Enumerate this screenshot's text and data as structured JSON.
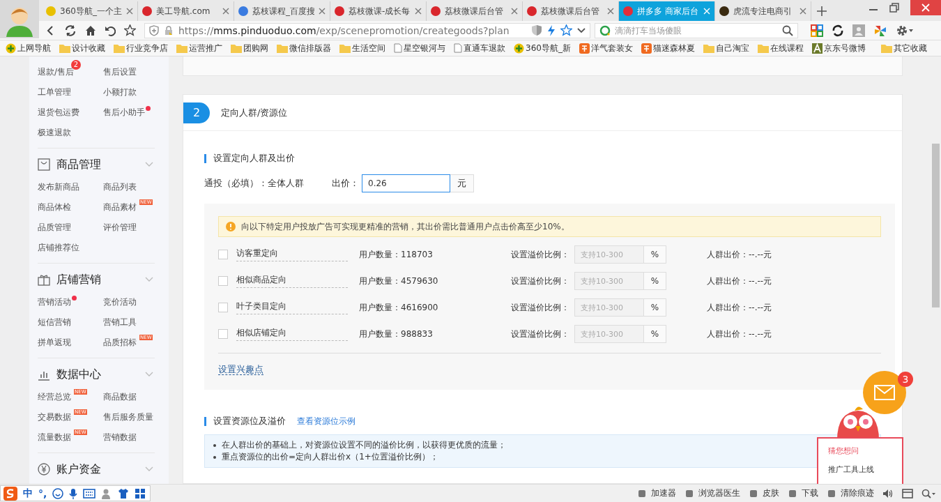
{
  "browser": {
    "tabs": [
      {
        "title": "360导航_一个主",
        "selected": false
      },
      {
        "title": "美工导航.com",
        "selected": false
      },
      {
        "title": "荔枝课程_百度搜",
        "selected": false
      },
      {
        "title": "荔枝微课-成长每",
        "selected": false
      },
      {
        "title": "荔枝微课后台管",
        "selected": false
      },
      {
        "title": "荔枝微课后台管",
        "selected": false
      },
      {
        "title": "拼多多 商家后台",
        "selected": true
      },
      {
        "title": "虎流专注电商引",
        "selected": false
      }
    ],
    "address": {
      "scheme": "https://",
      "host": "mms.pinduoduo.com",
      "path": "/exp/scenepromotion/creategoods?plan"
    },
    "search": {
      "placeholder": "滴滴打车当场傻眼"
    },
    "bookmarks": [
      {
        "label": "上网导航",
        "kind": "site"
      },
      {
        "label": "设计收藏",
        "kind": "folder"
      },
      {
        "label": "行业竞争店",
        "kind": "folder"
      },
      {
        "label": "运营推广",
        "kind": "folder"
      },
      {
        "label": "团购网",
        "kind": "folder"
      },
      {
        "label": "微信排版器",
        "kind": "folder"
      },
      {
        "label": "生活空间",
        "kind": "folder"
      },
      {
        "label": "星空银河与",
        "kind": "page"
      },
      {
        "label": "直通车退款",
        "kind": "page"
      },
      {
        "label": "360导航_新",
        "kind": "site"
      },
      {
        "label": "洋气套装女",
        "kind": "tao"
      },
      {
        "label": "猫迷森林夏",
        "kind": "tao"
      },
      {
        "label": "自己淘宝",
        "kind": "folder"
      },
      {
        "label": "在线课程",
        "kind": "folder"
      },
      {
        "label": "京东号微博",
        "kind": "letter"
      }
    ],
    "other_bookmarks": "其它收藏"
  },
  "sidebar": {
    "top_items": [
      {
        "label": "退款/售后",
        "badge": "2",
        "dot": false
      },
      {
        "label": "售后设置",
        "dot": false
      },
      {
        "label": "工单管理",
        "dot": false
      },
      {
        "label": "小额打款",
        "dot": false
      },
      {
        "label": "退货包运费",
        "dot": false
      },
      {
        "label": "售后小助手",
        "dot": true
      },
      {
        "label": "极速退款",
        "dot": false
      }
    ],
    "groups": [
      {
        "title": "商品管理",
        "items": [
          {
            "label": "发布新商品",
            "dot": false
          },
          {
            "label": "商品列表",
            "dot": false
          },
          {
            "label": "商品体检",
            "dot": false
          },
          {
            "label": "商品素材",
            "tag": "NEW",
            "dot": false
          },
          {
            "label": "品质管理",
            "dot": false
          },
          {
            "label": "评价管理",
            "dot": false
          },
          {
            "label": "店铺推荐位",
            "dot": false
          }
        ]
      },
      {
        "title": "店铺营销",
        "items": [
          {
            "label": "营销活动",
            "dot": true
          },
          {
            "label": "竞价活动",
            "dot": false
          },
          {
            "label": "短信营销",
            "dot": false
          },
          {
            "label": "营销工具",
            "dot": false
          },
          {
            "label": "拼单返现",
            "dot": false
          },
          {
            "label": "品质招标",
            "tag": "NEW",
            "dot": false
          }
        ]
      },
      {
        "title": "数据中心",
        "items": [
          {
            "label": "经营总览",
            "tag": "NEW",
            "dot": false
          },
          {
            "label": "商品数据",
            "dot": false
          },
          {
            "label": "交易数据",
            "tag": "NEW",
            "dot": false
          },
          {
            "label": "售后服务质量",
            "dot": false
          },
          {
            "label": "流量数据",
            "tag": "NEW",
            "dot": false
          },
          {
            "label": "营销数据",
            "dot": false
          }
        ]
      },
      {
        "title": "账户资金"
      }
    ]
  },
  "step": {
    "number": "2",
    "title": "定向人群/资源位"
  },
  "crowd_section": {
    "title": "设置定向人群及出价",
    "general_label": "通投（必填）：全体人群",
    "bid_label": "出价：",
    "bid_value": "0.26",
    "unit": "元",
    "notice": "向以下特定用户投放广告可实现更精准的营销，其出价需比普通用户点击价高至少10%。",
    "targets": [
      {
        "name": "访客重定向",
        "users": "用户数量：118703",
        "premium_label": "设置溢价比例：",
        "placeholder": "支持10-300",
        "percent": "%",
        "price": "人群出价：--.--元",
        "checked": false
      },
      {
        "name": "相似商品定向",
        "users": "用户数量：4579630",
        "premium_label": "设置溢价比例：",
        "placeholder": "支持10-300",
        "percent": "%",
        "price": "人群出价：--.--元",
        "checked": false
      },
      {
        "name": "叶子类目定向",
        "users": "用户数量：4616900",
        "premium_label": "设置溢价比例：",
        "placeholder": "支持10-300",
        "percent": "%",
        "price": "人群出价：--.--元",
        "checked": false
      },
      {
        "name": "相似店铺定向",
        "users": "用户数量：988833",
        "premium_label": "设置溢价比例：",
        "placeholder": "支持10-300",
        "percent": "%",
        "price": "人群出价：--.--元",
        "checked": false
      }
    ],
    "interest_link": "设置兴趣点"
  },
  "resource_section": {
    "title": "设置资源位及溢价",
    "example_link": "查看资源位示例",
    "bullets": [
      "在人群出价的基础上，对资源位设置不同的溢价比例，以获得更优质的流量；",
      "重点资源位的出价=定向人群出价x（1+位置溢价比例）；"
    ]
  },
  "chat": {
    "badge": "3",
    "popup_title": "猜您想问",
    "popup_item": "推广工具上线"
  },
  "ime": {
    "mode": "中",
    "punct": "°,"
  },
  "status_bar": [
    "加速器",
    "浏览器医生",
    "皮肤",
    "下载",
    "清除痕迹"
  ]
}
